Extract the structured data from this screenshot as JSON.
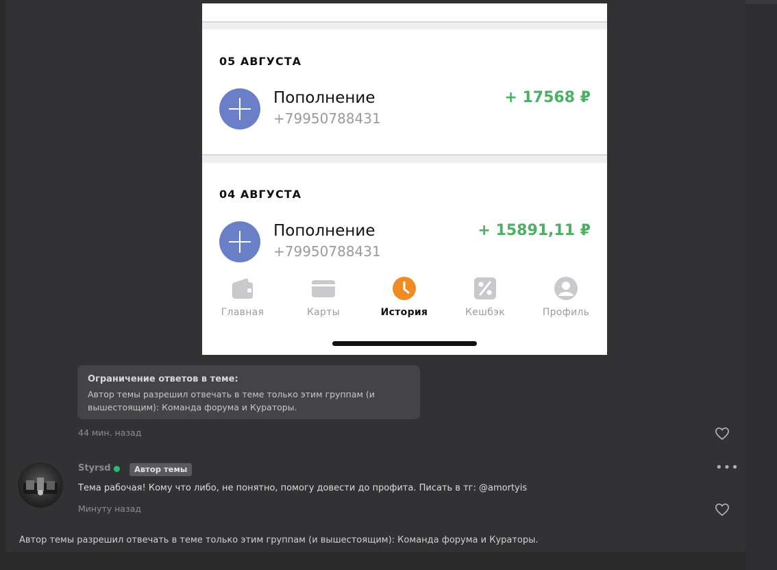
{
  "phone": {
    "transactions": [
      {
        "date": "05 АВГУСТА",
        "title": "Пополнение",
        "subtitle": "+79950788431",
        "amount": "+ 17568 ₽"
      },
      {
        "date": "04 АВГУСТА",
        "title": "Пополнение",
        "subtitle": "+79950788431",
        "amount": "+ 15891,11 ₽"
      }
    ],
    "tabs": [
      {
        "label": "Главная",
        "icon": "wallet-icon"
      },
      {
        "label": "Карты",
        "icon": "card-icon"
      },
      {
        "label": "История",
        "icon": "clock-icon",
        "active": true
      },
      {
        "label": "Кешбэк",
        "icon": "percent-icon"
      },
      {
        "label": "Профиль",
        "icon": "profile-icon"
      }
    ],
    "colors": {
      "accent": "#f08a24",
      "plus_circle": "#6b7fc9",
      "amount": "#4caf63"
    }
  },
  "notice": {
    "title": "Ограничение ответов в теме:",
    "text": "Автор темы разрешил отвечать в теме только этим группам (и вышестоящим): Команда форума и Кураторы."
  },
  "first_post": {
    "time": "44 мин. назад"
  },
  "post": {
    "username": "Styrsd",
    "badge": "Автор темы",
    "text": "Тема рабочая! Кому что либо, не понятно, помогу довести до профита. Писать в тг: @amortyis",
    "time": "Минуту назад"
  },
  "footer": {
    "text": "Автор темы разрешил отвечать в теме только этим группам (и вышестоящим): Команда форума и Кураторы."
  }
}
